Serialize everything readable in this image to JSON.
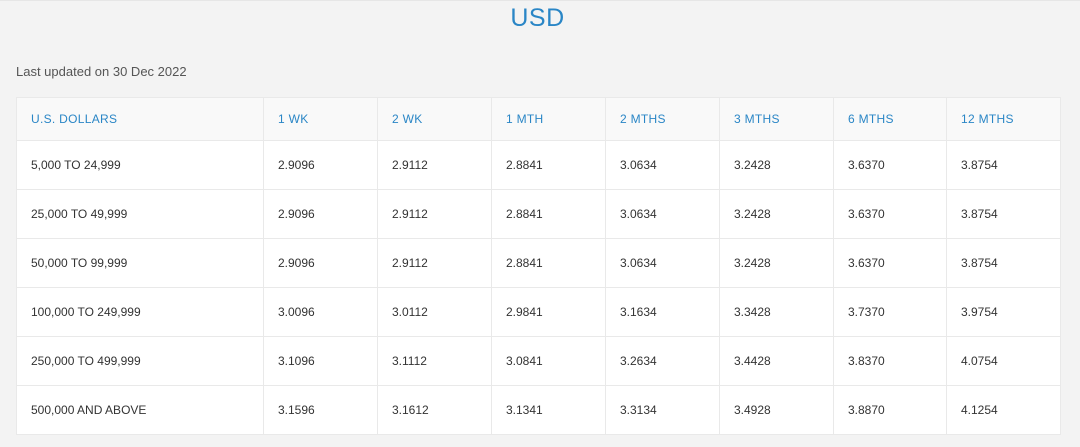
{
  "header": {
    "currency_title": "USD",
    "last_updated": "Last updated on 30 Dec 2022"
  },
  "table": {
    "columns": [
      "U.S. DOLLARS",
      "1 WK",
      "2 WK",
      "1 MTH",
      "2 MTHS",
      "3 MTHS",
      "6 MTHS",
      "12 MTHS"
    ],
    "rows": [
      [
        "5,000 TO 24,999",
        "2.9096",
        "2.9112",
        "2.8841",
        "3.0634",
        "3.2428",
        "3.6370",
        "3.8754"
      ],
      [
        "25,000 TO 49,999",
        "2.9096",
        "2.9112",
        "2.8841",
        "3.0634",
        "3.2428",
        "3.6370",
        "3.8754"
      ],
      [
        "50,000 TO 99,999",
        "2.9096",
        "2.9112",
        "2.8841",
        "3.0634",
        "3.2428",
        "3.6370",
        "3.8754"
      ],
      [
        "100,000 TO 249,999",
        "3.0096",
        "3.0112",
        "2.9841",
        "3.1634",
        "3.3428",
        "3.7370",
        "3.9754"
      ],
      [
        "250,000 TO 499,999",
        "3.1096",
        "3.1112",
        "3.0841",
        "3.2634",
        "3.4428",
        "3.8370",
        "4.0754"
      ],
      [
        "500,000 AND ABOVE",
        "3.1596",
        "3.1612",
        "3.1341",
        "3.3134",
        "3.4928",
        "3.8870",
        "4.1254"
      ]
    ]
  },
  "colors": {
    "accent": "#2a86c6",
    "background": "#f3f3f3",
    "table_bg": "#ffffff",
    "header_bg": "#f9f9f9",
    "border": "#e9e9e9"
  }
}
